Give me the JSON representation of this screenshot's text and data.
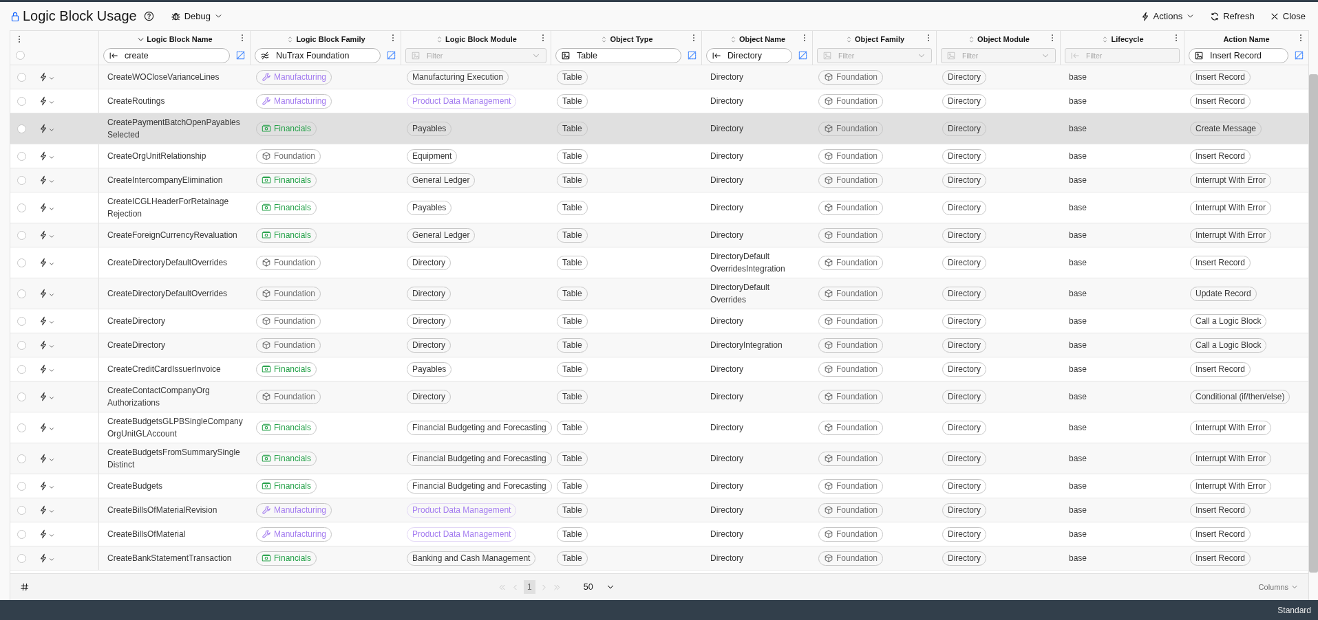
{
  "header": {
    "title": "Logic Block Usage",
    "mode_button": "Debug",
    "actions": [
      "Actions",
      "Refresh",
      "Close"
    ]
  },
  "select_all": {
    "checked": false
  },
  "columns": [
    {
      "label": "Logic Block Name",
      "sortable": true,
      "sorted": true,
      "filter": {
        "kind": "starts-with",
        "value": "create"
      }
    },
    {
      "label": "Logic Block Family",
      "sortable": true,
      "sorted": false,
      "filter": {
        "kind": "not-in",
        "value": "NuTrax Foundation"
      }
    },
    {
      "label": "Logic Block Module",
      "sortable": true,
      "sorted": false,
      "filter": {
        "kind": "picker",
        "placeholder": "Filter",
        "dropdown": true
      }
    },
    {
      "label": "Object Type",
      "sortable": true,
      "sorted": false,
      "filter": {
        "kind": "picker",
        "value": "Table"
      }
    },
    {
      "label": "Object Name",
      "sortable": true,
      "sorted": false,
      "filter": {
        "kind": "starts-with",
        "value": "Directory"
      }
    },
    {
      "label": "Object Family",
      "sortable": true,
      "sorted": false,
      "filter": {
        "kind": "picker",
        "placeholder": "Filter",
        "dropdown": true
      }
    },
    {
      "label": "Object Module",
      "sortable": true,
      "sorted": false,
      "filter": {
        "kind": "picker",
        "placeholder": "Filter",
        "dropdown": true
      }
    },
    {
      "label": "Lifecycle",
      "sortable": true,
      "sorted": false,
      "filter": {
        "kind": "starts-with",
        "placeholder": "Filter",
        "dropdown": false
      }
    },
    {
      "label": "Action Name",
      "sortable": false,
      "filter": {
        "kind": "picker",
        "value": "Insert Record"
      }
    }
  ],
  "rows": [
    {
      "selected": false,
      "name": [
        "CreateWOCloseVarianceLines"
      ],
      "family": {
        "label": "Manufacturing",
        "kind": "manufacturing"
      },
      "module": {
        "label": "Manufacturing Execution",
        "faded": false
      },
      "object_type": "Table",
      "object_name": [
        "Directory"
      ],
      "object_family": {
        "label": "Foundation",
        "kind": "foundation"
      },
      "object_module": "Directory",
      "lifecycle": "base",
      "action": "Insert Record"
    },
    {
      "selected": false,
      "name": [
        "CreateRoutings"
      ],
      "family": {
        "label": "Manufacturing",
        "kind": "manufacturing"
      },
      "module": {
        "label": "Product Data Management",
        "faded": true
      },
      "object_type": "Table",
      "object_name": [
        "Directory"
      ],
      "object_family": {
        "label": "Foundation",
        "kind": "foundation"
      },
      "object_module": "Directory",
      "lifecycle": "base",
      "action": "Insert Record"
    },
    {
      "selected": true,
      "name": [
        "CreatePaymentBatchOpenPayables",
        "Selected"
      ],
      "family": {
        "label": "Financials",
        "kind": "financials"
      },
      "module": {
        "label": "Payables",
        "faded": false
      },
      "object_type": "Table",
      "object_name": [
        "Directory"
      ],
      "object_family": {
        "label": "Foundation",
        "kind": "foundation"
      },
      "object_module": "Directory",
      "lifecycle": "base",
      "action": "Create Message"
    },
    {
      "selected": false,
      "name": [
        "CreateOrgUnitRelationship"
      ],
      "family": {
        "label": "Foundation",
        "kind": "foundation"
      },
      "module": {
        "label": "Equipment",
        "faded": false
      },
      "object_type": "Table",
      "object_name": [
        "Directory"
      ],
      "object_family": {
        "label": "Foundation",
        "kind": "foundation"
      },
      "object_module": "Directory",
      "lifecycle": "base",
      "action": "Insert Record"
    },
    {
      "selected": false,
      "name": [
        "CreateIntercompanyElimination"
      ],
      "family": {
        "label": "Financials",
        "kind": "financials"
      },
      "module": {
        "label": "General Ledger",
        "faded": false
      },
      "object_type": "Table",
      "object_name": [
        "Directory"
      ],
      "object_family": {
        "label": "Foundation",
        "kind": "foundation"
      },
      "object_module": "Directory",
      "lifecycle": "base",
      "action": "Interrupt With Error"
    },
    {
      "selected": false,
      "name": [
        "CreateICGLHeaderForRetainage",
        "Rejection"
      ],
      "family": {
        "label": "Financials",
        "kind": "financials"
      },
      "module": {
        "label": "Payables",
        "faded": false
      },
      "object_type": "Table",
      "object_name": [
        "Directory"
      ],
      "object_family": {
        "label": "Foundation",
        "kind": "foundation"
      },
      "object_module": "Directory",
      "lifecycle": "base",
      "action": "Interrupt With Error"
    },
    {
      "selected": false,
      "name": [
        "CreateForeignCurrencyRevaluation"
      ],
      "family": {
        "label": "Financials",
        "kind": "financials"
      },
      "module": {
        "label": "General Ledger",
        "faded": false
      },
      "object_type": "Table",
      "object_name": [
        "Directory"
      ],
      "object_family": {
        "label": "Foundation",
        "kind": "foundation"
      },
      "object_module": "Directory",
      "lifecycle": "base",
      "action": "Interrupt With Error"
    },
    {
      "selected": false,
      "name": [
        "CreateDirectoryDefaultOverrides"
      ],
      "family": {
        "label": "Foundation",
        "kind": "foundation"
      },
      "module": {
        "label": "Directory",
        "faded": false
      },
      "object_type": "Table",
      "object_name": [
        "DirectoryDefault",
        "OverridesIntegration"
      ],
      "object_family": {
        "label": "Foundation",
        "kind": "foundation"
      },
      "object_module": "Directory",
      "lifecycle": "base",
      "action": "Insert Record"
    },
    {
      "selected": false,
      "name": [
        "CreateDirectoryDefaultOverrides"
      ],
      "family": {
        "label": "Foundation",
        "kind": "foundation"
      },
      "module": {
        "label": "Directory",
        "faded": false
      },
      "object_type": "Table",
      "object_name": [
        "DirectoryDefault",
        "Overrides"
      ],
      "object_family": {
        "label": "Foundation",
        "kind": "foundation"
      },
      "object_module": "Directory",
      "lifecycle": "base",
      "action": "Update Record"
    },
    {
      "selected": false,
      "name": [
        "CreateDirectory"
      ],
      "family": {
        "label": "Foundation",
        "kind": "foundation"
      },
      "module": {
        "label": "Directory",
        "faded": false
      },
      "object_type": "Table",
      "object_name": [
        "Directory"
      ],
      "object_family": {
        "label": "Foundation",
        "kind": "foundation"
      },
      "object_module": "Directory",
      "lifecycle": "base",
      "action": "Call a Logic Block"
    },
    {
      "selected": false,
      "name": [
        "CreateDirectory"
      ],
      "family": {
        "label": "Foundation",
        "kind": "foundation"
      },
      "module": {
        "label": "Directory",
        "faded": false
      },
      "object_type": "Table",
      "object_name": [
        "DirectoryIntegration"
      ],
      "object_family": {
        "label": "Foundation",
        "kind": "foundation"
      },
      "object_module": "Directory",
      "lifecycle": "base",
      "action": "Call a Logic Block"
    },
    {
      "selected": false,
      "name": [
        "CreateCreditCardIssuerInvoice"
      ],
      "family": {
        "label": "Financials",
        "kind": "financials"
      },
      "module": {
        "label": "Payables",
        "faded": false
      },
      "object_type": "Table",
      "object_name": [
        "Directory"
      ],
      "object_family": {
        "label": "Foundation",
        "kind": "foundation"
      },
      "object_module": "Directory",
      "lifecycle": "base",
      "action": "Insert Record"
    },
    {
      "selected": false,
      "name": [
        "CreateContactCompanyOrg",
        "Authorizations"
      ],
      "family": {
        "label": "Foundation",
        "kind": "foundation"
      },
      "module": {
        "label": "Directory",
        "faded": false
      },
      "object_type": "Table",
      "object_name": [
        "Directory"
      ],
      "object_family": {
        "label": "Foundation",
        "kind": "foundation"
      },
      "object_module": "Directory",
      "lifecycle": "base",
      "action": "Conditional (if/then/else)"
    },
    {
      "selected": false,
      "name": [
        "CreateBudgetsGLPBSingleCompany",
        "OrgUnitGLAccount"
      ],
      "family": {
        "label": "Financials",
        "kind": "financials"
      },
      "module": {
        "label": "Financial Budgeting and Forecasting",
        "faded": false
      },
      "object_type": "Table",
      "object_name": [
        "Directory"
      ],
      "object_family": {
        "label": "Foundation",
        "kind": "foundation"
      },
      "object_module": "Directory",
      "lifecycle": "base",
      "action": "Interrupt With Error"
    },
    {
      "selected": false,
      "name": [
        "CreateBudgetsFromSummarySingle",
        "Distinct"
      ],
      "family": {
        "label": "Financials",
        "kind": "financials"
      },
      "module": {
        "label": "Financial Budgeting and Forecasting",
        "faded": false
      },
      "object_type": "Table",
      "object_name": [
        "Directory"
      ],
      "object_family": {
        "label": "Foundation",
        "kind": "foundation"
      },
      "object_module": "Directory",
      "lifecycle": "base",
      "action": "Interrupt With Error"
    },
    {
      "selected": false,
      "name": [
        "CreateBudgets"
      ],
      "family": {
        "label": "Financials",
        "kind": "financials"
      },
      "module": {
        "label": "Financial Budgeting and Forecasting",
        "faded": false
      },
      "object_type": "Table",
      "object_name": [
        "Directory"
      ],
      "object_family": {
        "label": "Foundation",
        "kind": "foundation"
      },
      "object_module": "Directory",
      "lifecycle": "base",
      "action": "Interrupt With Error"
    },
    {
      "selected": false,
      "name": [
        "CreateBillsOfMaterialRevision"
      ],
      "family": {
        "label": "Manufacturing",
        "kind": "manufacturing"
      },
      "module": {
        "label": "Product Data Management",
        "faded": true
      },
      "object_type": "Table",
      "object_name": [
        "Directory"
      ],
      "object_family": {
        "label": "Foundation",
        "kind": "foundation"
      },
      "object_module": "Directory",
      "lifecycle": "base",
      "action": "Insert Record"
    },
    {
      "selected": false,
      "name": [
        "CreateBillsOfMaterial"
      ],
      "family": {
        "label": "Manufacturing",
        "kind": "manufacturing"
      },
      "module": {
        "label": "Product Data Management",
        "faded": true
      },
      "object_type": "Table",
      "object_name": [
        "Directory"
      ],
      "object_family": {
        "label": "Foundation",
        "kind": "foundation"
      },
      "object_module": "Directory",
      "lifecycle": "base",
      "action": "Insert Record"
    },
    {
      "selected": false,
      "name": [
        "CreateBankStatementTransaction"
      ],
      "family": {
        "label": "Financials",
        "kind": "financials"
      },
      "module": {
        "label": "Banking and Cash Management",
        "faded": false
      },
      "object_type": "Table",
      "object_name": [
        "Directory"
      ],
      "object_family": {
        "label": "Foundation",
        "kind": "foundation"
      },
      "object_module": "Directory",
      "lifecycle": "base",
      "action": "Insert Record"
    }
  ],
  "pagination": {
    "pages": [
      {
        "label": "1",
        "selected": true
      }
    ],
    "page_size": "50",
    "columns_button": "Columns"
  },
  "status_bar": {
    "text": "Standard"
  }
}
